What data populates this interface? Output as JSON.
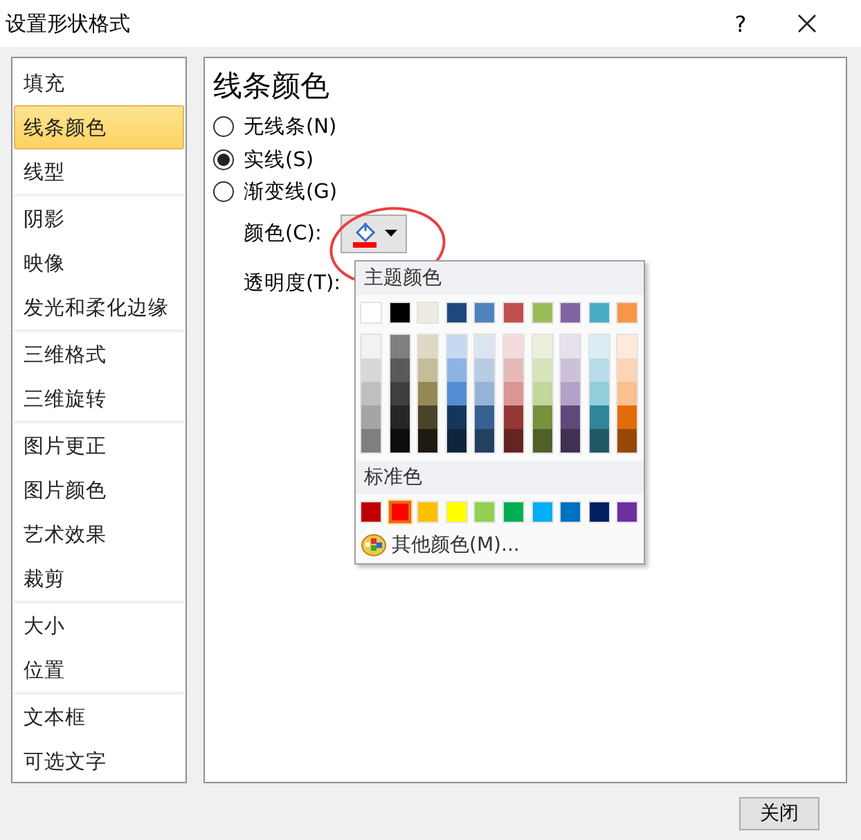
{
  "window": {
    "title": "设置形状格式",
    "help_button": "?"
  },
  "sidebar": {
    "groups": [
      {
        "items": [
          {
            "label": "填充",
            "selected": false
          },
          {
            "label": "线条颜色",
            "selected": true
          },
          {
            "label": "线型",
            "selected": false
          }
        ]
      },
      {
        "items": [
          {
            "label": "阴影",
            "selected": false
          },
          {
            "label": "映像",
            "selected": false
          },
          {
            "label": "发光和柔化边缘",
            "selected": false
          }
        ]
      },
      {
        "items": [
          {
            "label": "三维格式",
            "selected": false
          },
          {
            "label": "三维旋转",
            "selected": false
          }
        ]
      },
      {
        "items": [
          {
            "label": "图片更正",
            "selected": false
          },
          {
            "label": "图片颜色",
            "selected": false
          },
          {
            "label": "艺术效果",
            "selected": false
          },
          {
            "label": "裁剪",
            "selected": false
          }
        ]
      },
      {
        "items": [
          {
            "label": "大小",
            "selected": false
          },
          {
            "label": "位置",
            "selected": false
          }
        ]
      },
      {
        "items": [
          {
            "label": "文本框",
            "selected": false
          },
          {
            "label": "可选文字",
            "selected": false
          }
        ]
      }
    ]
  },
  "panel": {
    "heading": "线条颜色",
    "line_options": [
      {
        "label": "无线条(N)",
        "selected": false
      },
      {
        "label": "实线(S)",
        "selected": true
      },
      {
        "label": "渐变线(G)",
        "selected": false
      }
    ],
    "color_label": "颜色(C):",
    "color_button": {
      "color": "#ff0000",
      "highlighted": true
    },
    "transparency_label": "透明度(T):"
  },
  "color_popup": {
    "theme_heading": "主题颜色",
    "theme_colors": [
      {
        "color": "#ffffff",
        "selected": false
      },
      {
        "color": "#000000",
        "selected": false
      },
      {
        "color": "#eeece1",
        "selected": false
      },
      {
        "color": "#1f497d",
        "selected": false
      },
      {
        "color": "#4f81bd",
        "selected": false
      },
      {
        "color": "#c0504d",
        "selected": false
      },
      {
        "color": "#9bbb59",
        "selected": false
      },
      {
        "color": "#8064a2",
        "selected": false
      },
      {
        "color": "#4bacc6",
        "selected": false
      },
      {
        "color": "#f79646",
        "selected": false
      }
    ],
    "shade_columns": [
      {
        "shades": [
          {
            "color": "#f2f2f2"
          },
          {
            "color": "#d8d8d8"
          },
          {
            "color": "#bfbfbf"
          },
          {
            "color": "#a5a5a5"
          },
          {
            "color": "#7f7f7f"
          }
        ]
      },
      {
        "shades": [
          {
            "color": "#7f7f7f"
          },
          {
            "color": "#595959"
          },
          {
            "color": "#3f3f3f"
          },
          {
            "color": "#262626"
          },
          {
            "color": "#0c0c0c"
          }
        ]
      },
      {
        "shades": [
          {
            "color": "#ddd9c3"
          },
          {
            "color": "#c4bd97"
          },
          {
            "color": "#938953"
          },
          {
            "color": "#494429"
          },
          {
            "color": "#1d1b10"
          }
        ]
      },
      {
        "shades": [
          {
            "color": "#c6d9f0"
          },
          {
            "color": "#8db3e2"
          },
          {
            "color": "#548dd4"
          },
          {
            "color": "#17365d"
          },
          {
            "color": "#0f243e"
          }
        ]
      },
      {
        "shades": [
          {
            "color": "#dbe5f1"
          },
          {
            "color": "#b8cce4"
          },
          {
            "color": "#95b3d7"
          },
          {
            "color": "#366092"
          },
          {
            "color": "#244061"
          }
        ]
      },
      {
        "shades": [
          {
            "color": "#f2dcdb"
          },
          {
            "color": "#e5b9b7"
          },
          {
            "color": "#d99694"
          },
          {
            "color": "#953734"
          },
          {
            "color": "#632423"
          }
        ]
      },
      {
        "shades": [
          {
            "color": "#ebf1dd"
          },
          {
            "color": "#d7e3bc"
          },
          {
            "color": "#c3d69b"
          },
          {
            "color": "#76923c"
          },
          {
            "color": "#4f6128"
          }
        ]
      },
      {
        "shades": [
          {
            "color": "#e5e0ec"
          },
          {
            "color": "#ccc1d9"
          },
          {
            "color": "#b2a2c7"
          },
          {
            "color": "#5f497a"
          },
          {
            "color": "#3f3151"
          }
        ]
      },
      {
        "shades": [
          {
            "color": "#dbeef3"
          },
          {
            "color": "#b7dde8"
          },
          {
            "color": "#92cddc"
          },
          {
            "color": "#31859b"
          },
          {
            "color": "#205867"
          }
        ]
      },
      {
        "shades": [
          {
            "color": "#fdeada"
          },
          {
            "color": "#fbd5b5"
          },
          {
            "color": "#fac08f"
          },
          {
            "color": "#e36c09"
          },
          {
            "color": "#974806"
          }
        ]
      }
    ],
    "standard_heading": "标准色",
    "standard_colors": [
      {
        "color": "#c00000",
        "selected": false
      },
      {
        "color": "#ff0000",
        "selected": true
      },
      {
        "color": "#ffc000",
        "selected": false
      },
      {
        "color": "#ffff00",
        "selected": false
      },
      {
        "color": "#92d050",
        "selected": false
      },
      {
        "color": "#00b050",
        "selected": false
      },
      {
        "color": "#00b0f0",
        "selected": false
      },
      {
        "color": "#0070c0",
        "selected": false
      },
      {
        "color": "#002060",
        "selected": false
      },
      {
        "color": "#7030a0",
        "selected": false
      }
    ],
    "more_colors": "其他颜色(M)..."
  },
  "footer": {
    "close_button": "关闭"
  }
}
